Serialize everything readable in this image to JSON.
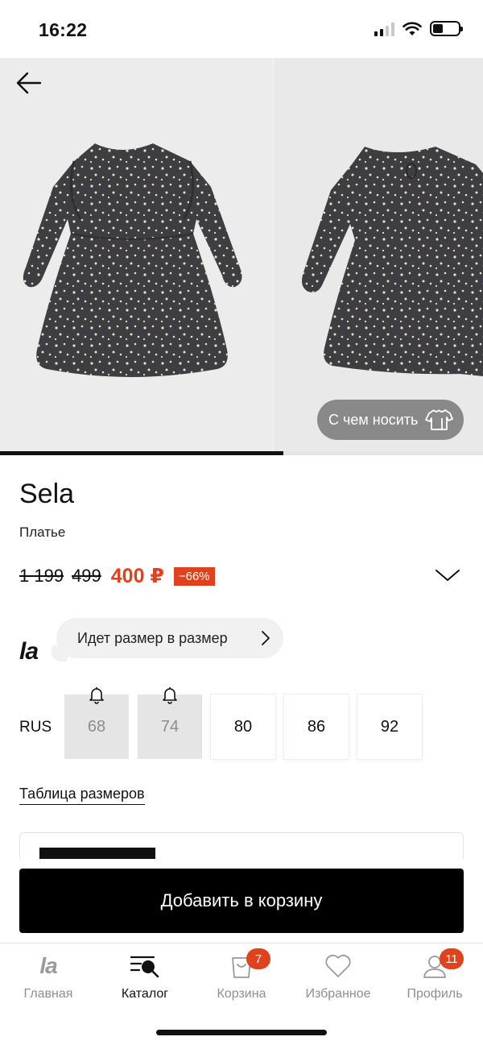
{
  "status_bar": {
    "time": "16:22"
  },
  "gallery": {
    "outfit_button_label": "С чем носить",
    "progress": 0.586,
    "photos": [
      "dress-front-photo",
      "dress-back-photo"
    ]
  },
  "product": {
    "brand": "Sela",
    "type": "Платье",
    "old_price_1": "1 199",
    "old_price_2": "499",
    "new_price": "400 ₽",
    "discount": "−66%"
  },
  "fit": {
    "logo": "la",
    "text": "Идет размер в размер"
  },
  "sizes": {
    "system": "RUS",
    "items": [
      {
        "label": "68",
        "available": false
      },
      {
        "label": "74",
        "available": false
      },
      {
        "label": "80",
        "available": true
      },
      {
        "label": "86",
        "available": true
      },
      {
        "label": "92",
        "available": true
      }
    ]
  },
  "size_table_link": "Таблица размеров",
  "add_to_cart_label": "Добавить в корзину",
  "bottom_nav": {
    "items": [
      {
        "label": "Главная",
        "icon": "la-logo-icon",
        "active": false
      },
      {
        "label": "Каталог",
        "icon": "catalog-search-icon",
        "active": true
      },
      {
        "label": "Корзина",
        "icon": "bag-icon",
        "badge": "7",
        "active": false
      },
      {
        "label": "Избранное",
        "icon": "heart-icon",
        "active": false
      },
      {
        "label": "Профиль",
        "icon": "profile-icon",
        "badge": "11",
        "active": false
      }
    ]
  },
  "colors": {
    "accent": "#e0421e",
    "primary": "#000000",
    "muted_text": "#8f8f8f"
  }
}
